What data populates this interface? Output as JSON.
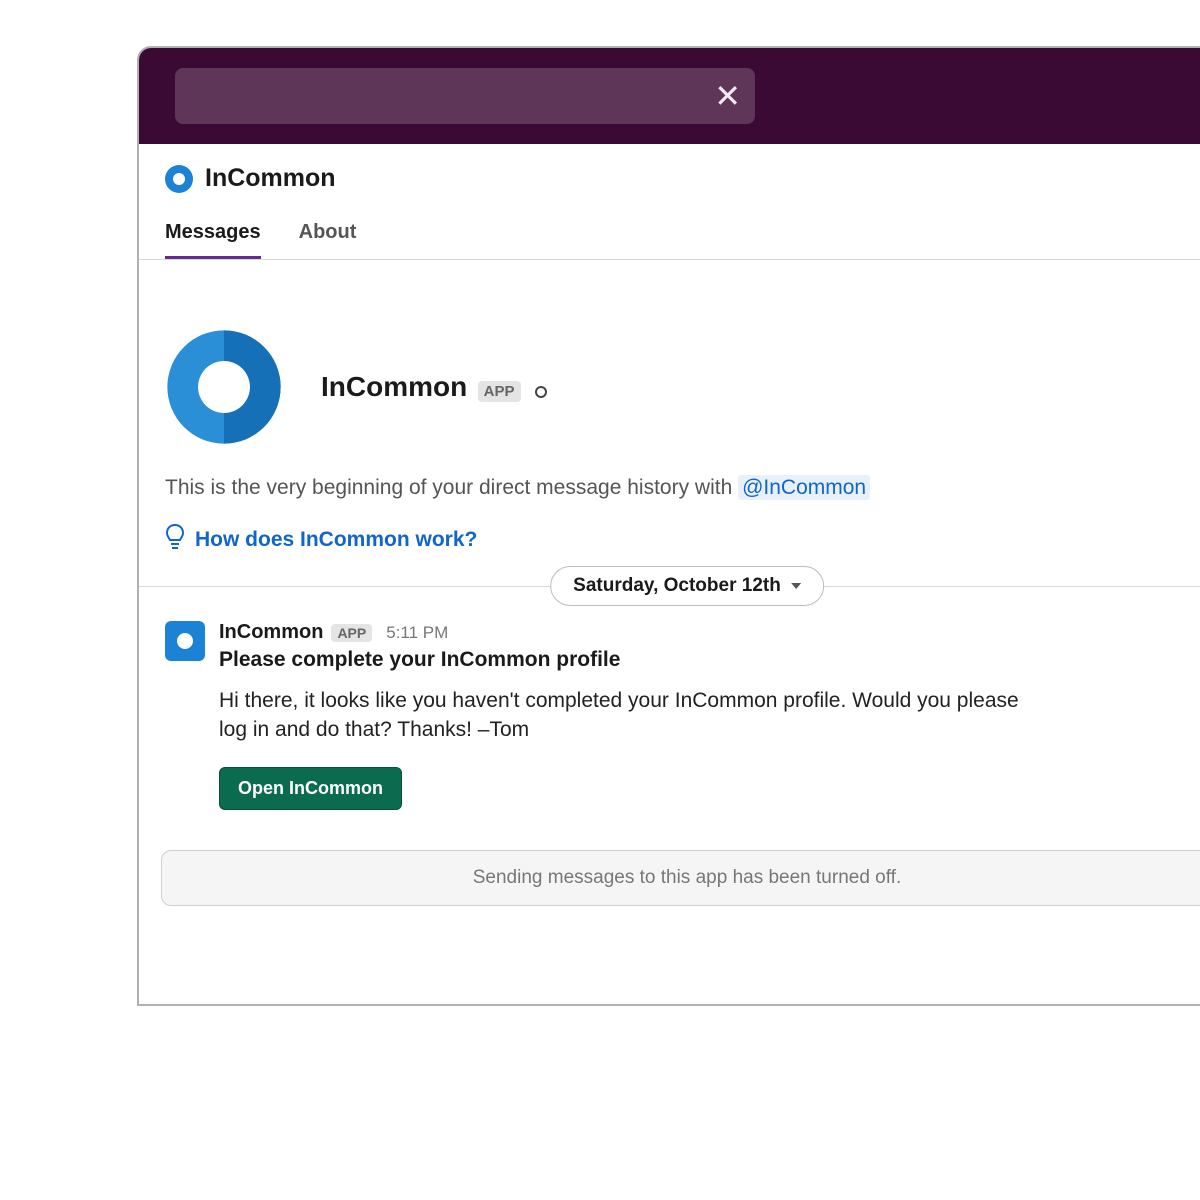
{
  "header": {
    "app_name": "InCommon"
  },
  "tabs": {
    "messages": "Messages",
    "about": "About"
  },
  "intro": {
    "name": "InCommon",
    "badge": "APP",
    "history_text_prefix": "This is the very beginning of your direct message history with ",
    "mention": "@InCommon",
    "help_link": "How does InCommon work?"
  },
  "divider": {
    "date": "Saturday, October 12th"
  },
  "message": {
    "author": "InCommon",
    "badge": "APP",
    "time": "5:11 PM",
    "title": "Please complete your InCommon profile",
    "body": "Hi there, it looks like you haven't completed your InCommon profile. Would you please log in and do that? Thanks!  –Tom",
    "button": "Open InCommon"
  },
  "composer": {
    "notice": "Sending messages to this app has been turned off."
  }
}
